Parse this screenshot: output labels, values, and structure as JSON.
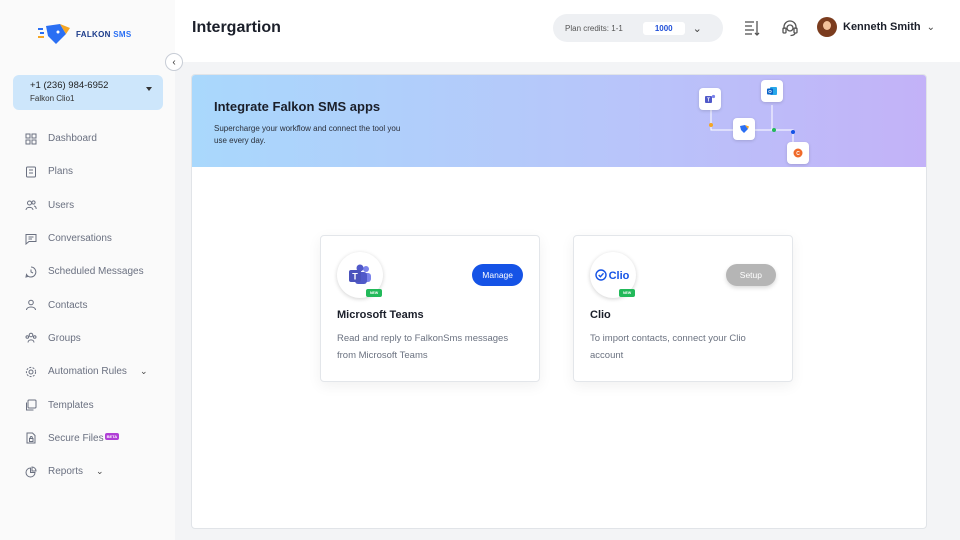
{
  "brand": {
    "name_part1": "FALKON",
    "name_part2": "SMS"
  },
  "sidebar": {
    "phone": {
      "number": "+1 (236) 984-6952",
      "label": "Falkon Clio1"
    },
    "items": [
      {
        "label": "Dashboard",
        "icon": "dashboard-icon"
      },
      {
        "label": "Plans",
        "icon": "plans-icon"
      },
      {
        "label": "Users",
        "icon": "users-icon"
      },
      {
        "label": "Conversations",
        "icon": "chat-icon"
      },
      {
        "label": "Scheduled Messages",
        "icon": "schedule-icon"
      },
      {
        "label": "Contacts",
        "icon": "contact-icon"
      },
      {
        "label": "Groups",
        "icon": "groups-icon"
      },
      {
        "label": "Automation Rules",
        "icon": "automation-icon"
      },
      {
        "label": "Templates",
        "icon": "templates-icon"
      },
      {
        "label": "Secure Files",
        "icon": "secure-files-icon",
        "badge": "BETA"
      },
      {
        "label": "Reports",
        "icon": "reports-icon"
      }
    ]
  },
  "header": {
    "title": "Intergartion",
    "credits_label": "Plan credits: 1-1",
    "credits_value": "1000",
    "user_name": "Kenneth Smith"
  },
  "banner": {
    "title": "Integrate Falkon SMS apps",
    "subtitle": "Supercharge your workflow and connect the tool you use every day."
  },
  "integrations": [
    {
      "name": "Microsoft Teams",
      "tag": "NEW",
      "description": "Read and reply to FalkonSms messages from Microsoft Teams",
      "action": "Manage"
    },
    {
      "name": "Clio",
      "logo_text": "Clio",
      "tag": "NEW",
      "description": "To import contacts, connect your Clio account",
      "action": "Setup"
    }
  ],
  "colors": {
    "primary": "#1553e6",
    "accent_green": "#22b95a",
    "sidebar_selected_bg": "#cde6fb"
  }
}
